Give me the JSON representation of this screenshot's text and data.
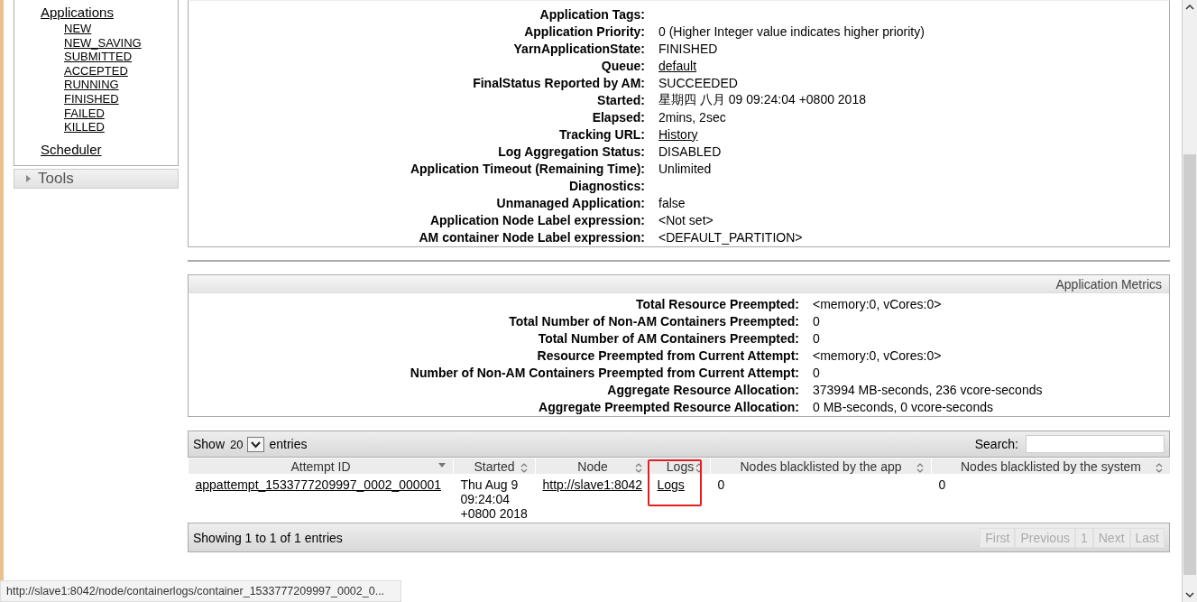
{
  "sidebar": {
    "applications": {
      "label": "Applications",
      "children": [
        {
          "label": "NEW"
        },
        {
          "label": "NEW_SAVING"
        },
        {
          "label": "SUBMITTED"
        },
        {
          "label": "ACCEPTED"
        },
        {
          "label": "RUNNING"
        },
        {
          "label": "FINISHED"
        },
        {
          "label": "FAILED"
        },
        {
          "label": "KILLED"
        }
      ]
    },
    "scheduler": "Scheduler",
    "tools": {
      "label": "Tools",
      "expanded": false
    }
  },
  "overview": [
    {
      "label": "Application Tags:"
    },
    {
      "label": "Application Priority:",
      "value": "0 (Higher Integer value indicates higher priority)"
    },
    {
      "label": "YarnApplicationState:",
      "value": "FINISHED"
    },
    {
      "label": "Queue:",
      "value": "default",
      "kind": "link"
    },
    {
      "label": "FinalStatus Reported by AM:",
      "value": "SUCCEEDED"
    },
    {
      "label": "Started:",
      "value": "星期四 八月 09 09:24:04 +0800 2018"
    },
    {
      "label": "Elapsed:",
      "value": "2mins, 2sec"
    },
    {
      "label": "Tracking URL:",
      "value": "History",
      "kind": "link"
    },
    {
      "label": "Log Aggregation Status:",
      "value": "DISABLED"
    },
    {
      "label": "Application Timeout (Remaining Time):",
      "value": "Unlimited"
    },
    {
      "label": "Diagnostics:"
    },
    {
      "label": "Unmanaged Application:",
      "value": "false"
    },
    {
      "label": "Application Node Label expression:",
      "value": "<Not set>"
    },
    {
      "label": "AM container Node Label expression:",
      "value": "<DEFAULT_PARTITION>"
    }
  ],
  "metrics": {
    "title": "Application Metrics",
    "rows": [
      {
        "label": "Total Resource Preempted:",
        "value": "<memory:0, vCores:0>"
      },
      {
        "label": "Total Number of Non-AM Containers Preempted:",
        "value": "0"
      },
      {
        "label": "Total Number of AM Containers Preempted:",
        "value": "0"
      },
      {
        "label": "Resource Preempted from Current Attempt:",
        "value": "<memory:0, vCores:0>"
      },
      {
        "label": "Number of Non-AM Containers Preempted from Current Attempt:",
        "value": "0"
      },
      {
        "label": "Aggregate Resource Allocation:",
        "value": "373994 MB-seconds, 236 vcore-seconds"
      },
      {
        "label": "Aggregate Preempted Resource Allocation:",
        "value": "0 MB-seconds, 0 vcore-seconds"
      }
    ]
  },
  "attempts": {
    "show_label": "Show",
    "page_size": "20",
    "entries_label": "entries",
    "search_label": "Search:",
    "columns": [
      {
        "label": "Attempt ID",
        "sorted": true,
        "highlighted": false
      },
      {
        "label": "Started",
        "sorted": false,
        "highlighted": false
      },
      {
        "label": "Node",
        "sorted": false,
        "highlighted": false
      },
      {
        "label": "Logs",
        "sorted": false,
        "highlighted": true
      },
      {
        "label": "Nodes blacklisted by the app",
        "sorted": false,
        "highlighted": false
      },
      {
        "label": "Nodes blacklisted by the system",
        "sorted": false,
        "highlighted": false
      }
    ],
    "rows": [
      {
        "cells": [
          {
            "text": "appattempt_1533777209997_0002_000001",
            "kind": "link"
          },
          {
            "text": "Thu Aug 9 09:24:04 +0800 2018",
            "kind": "text"
          },
          {
            "text": "http://slave1:8042",
            "kind": "link"
          },
          {
            "text": "Logs",
            "kind": "link"
          },
          {
            "text": "0",
            "kind": "text"
          },
          {
            "text": "0",
            "kind": "text"
          }
        ]
      }
    ],
    "info": "Showing 1 to 1 of 1 entries",
    "pagination": [
      {
        "label": "First",
        "disabled": true
      },
      {
        "label": "Previous",
        "disabled": true
      },
      {
        "label": "1",
        "disabled": true
      },
      {
        "label": "Next",
        "disabled": true
      },
      {
        "label": "Last",
        "disabled": true
      }
    ]
  },
  "status_url": "http://slave1:8042/node/containerlogs/container_1533777209997_0002_0..."
}
